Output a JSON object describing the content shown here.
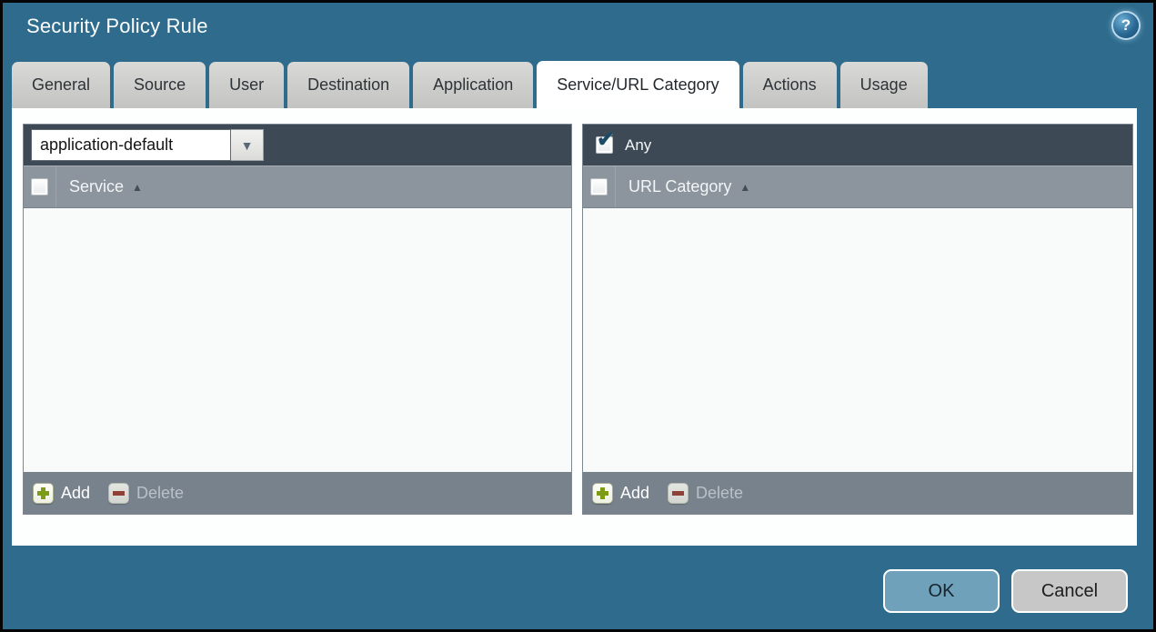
{
  "window": {
    "title": "Security Policy Rule",
    "help_glyph": "?"
  },
  "tabs": [
    {
      "label": "General",
      "active": false
    },
    {
      "label": "Source",
      "active": false
    },
    {
      "label": "User",
      "active": false
    },
    {
      "label": "Destination",
      "active": false
    },
    {
      "label": "Application",
      "active": false
    },
    {
      "label": "Service/URL Category",
      "active": true
    },
    {
      "label": "Actions",
      "active": false
    },
    {
      "label": "Usage",
      "active": false
    }
  ],
  "service_panel": {
    "dropdown": {
      "value": "application-default",
      "arrow_glyph": "▼"
    },
    "header_checkbox_checked": false,
    "column_header": "Service",
    "sort_arrow_glyph": "▲",
    "rows": [],
    "add_label": "Add",
    "delete_label": "Delete",
    "delete_disabled": true
  },
  "url_category_panel": {
    "any": {
      "label": "Any",
      "checked": true,
      "check_glyph": "✔"
    },
    "header_checkbox_checked": false,
    "column_header": "URL Category",
    "sort_arrow_glyph": "▲",
    "rows": [],
    "add_label": "Add",
    "delete_label": "Delete",
    "delete_disabled": true
  },
  "dialog_actions": {
    "ok_label": "OK",
    "cancel_label": "Cancel"
  },
  "colors": {
    "dialog_background": "#2e6b8c",
    "panel_header": "#3d4a55",
    "table_header": "#8c959e",
    "footer_bar": "#78828d",
    "active_tab": "#ffffff",
    "inactive_tab": "#c9c9c7",
    "ok_button": "#6fa2ba",
    "cancel_button": "#c7c7c7",
    "add_plus": "#7d9b17",
    "delete_minus": "#8e4136",
    "checkmark": "#1c4b66"
  }
}
